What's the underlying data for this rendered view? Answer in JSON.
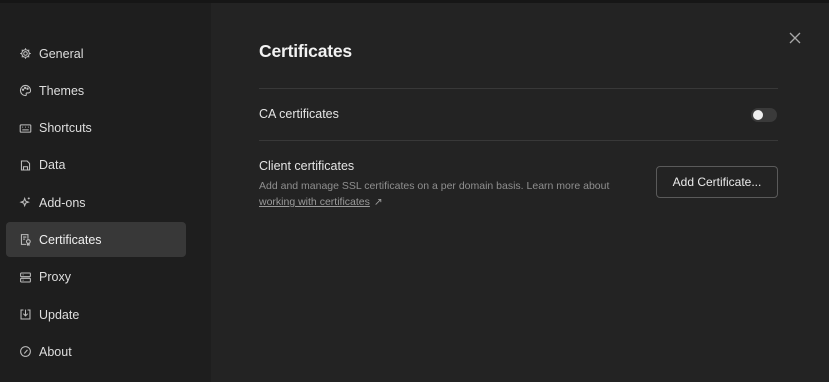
{
  "sidebar": {
    "items": [
      {
        "label": "General",
        "icon": "gear-icon",
        "active": false
      },
      {
        "label": "Themes",
        "icon": "palette-icon",
        "active": false
      },
      {
        "label": "Shortcuts",
        "icon": "keyboard-icon",
        "active": false
      },
      {
        "label": "Data",
        "icon": "database-icon",
        "active": false
      },
      {
        "label": "Add-ons",
        "icon": "sparkle-icon",
        "active": false
      },
      {
        "label": "Certificates",
        "icon": "certificate-icon",
        "active": true
      },
      {
        "label": "Proxy",
        "icon": "server-icon",
        "active": false
      },
      {
        "label": "Update",
        "icon": "download-icon",
        "active": false
      },
      {
        "label": "About",
        "icon": "info-icon",
        "active": false
      }
    ]
  },
  "main": {
    "title": "Certificates",
    "ca_certificates": {
      "label": "CA certificates",
      "enabled": false
    },
    "client_certificates": {
      "label": "Client certificates",
      "description": "Add and manage SSL certificates on a per domain basis. Learn more about ",
      "link_text": "working with certificates",
      "link_arrow": "↗",
      "button_label": "Add Certificate..."
    }
  },
  "colors": {
    "background": "#232323",
    "sidebar_background": "#1e1e1e",
    "active_item": "#383838",
    "divider": "#383838",
    "muted_text": "#8f8f8f"
  }
}
